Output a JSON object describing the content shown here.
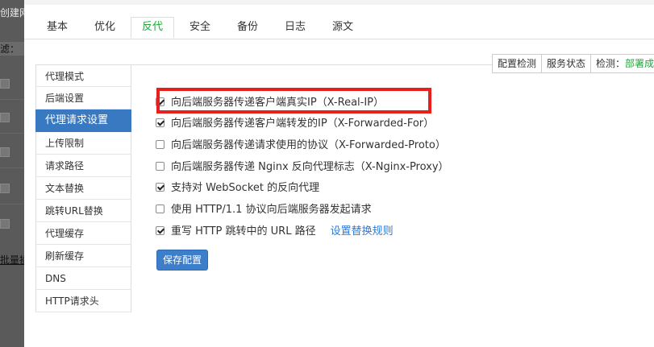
{
  "background": {
    "title": "创建网",
    "filter_label": "滤：",
    "link_text": "批量操"
  },
  "tabs": [
    {
      "label": "基本"
    },
    {
      "label": "优化"
    },
    {
      "label": "反代"
    },
    {
      "label": "安全"
    },
    {
      "label": "备份"
    },
    {
      "label": "日志"
    },
    {
      "label": "源文"
    }
  ],
  "active_tab": "反代",
  "sidemenu": [
    {
      "label": "代理模式"
    },
    {
      "label": "后端设置"
    },
    {
      "label": "代理请求设置"
    },
    {
      "label": "上传限制"
    },
    {
      "label": "请求路径"
    },
    {
      "label": "文本替换"
    },
    {
      "label": "跳转URL替换"
    },
    {
      "label": "代理缓存"
    },
    {
      "label": "刷新缓存"
    },
    {
      "label": "DNS"
    },
    {
      "label": "HTTP请求头"
    }
  ],
  "active_menu": "代理请求设置",
  "status": {
    "config_check": "配置检测",
    "service_status": "服务状态",
    "check_label": "检测：",
    "check_value": "部署成"
  },
  "options": [
    {
      "label": "向后端服务器传递客户端真实IP（X-Real-IP）",
      "checked": true
    },
    {
      "label": "向后端服务器传递客户端转发的IP（X-Forwarded-For）",
      "checked": true
    },
    {
      "label": "向后端服务器传递请求使用的协议（X-Forwarded-Proto）",
      "checked": false
    },
    {
      "label": "向后端服务器传递 Nginx 反向代理标志（X-Nginx-Proxy）",
      "checked": false
    },
    {
      "label": "支持对 WebSocket 的反向代理",
      "checked": true
    },
    {
      "label": "使用 HTTP/1.1 协议向后端服务器发起请求",
      "checked": false
    },
    {
      "label": "重写 HTTP 跳转中的 URL 路径",
      "checked": true,
      "link": "设置替换规则"
    }
  ],
  "save_button": "保存配置",
  "colors": {
    "accent_green": "#20a53a",
    "menu_active": "#3879c2",
    "highlight_red": "#e8201d",
    "link_blue": "#2f7bd5"
  }
}
